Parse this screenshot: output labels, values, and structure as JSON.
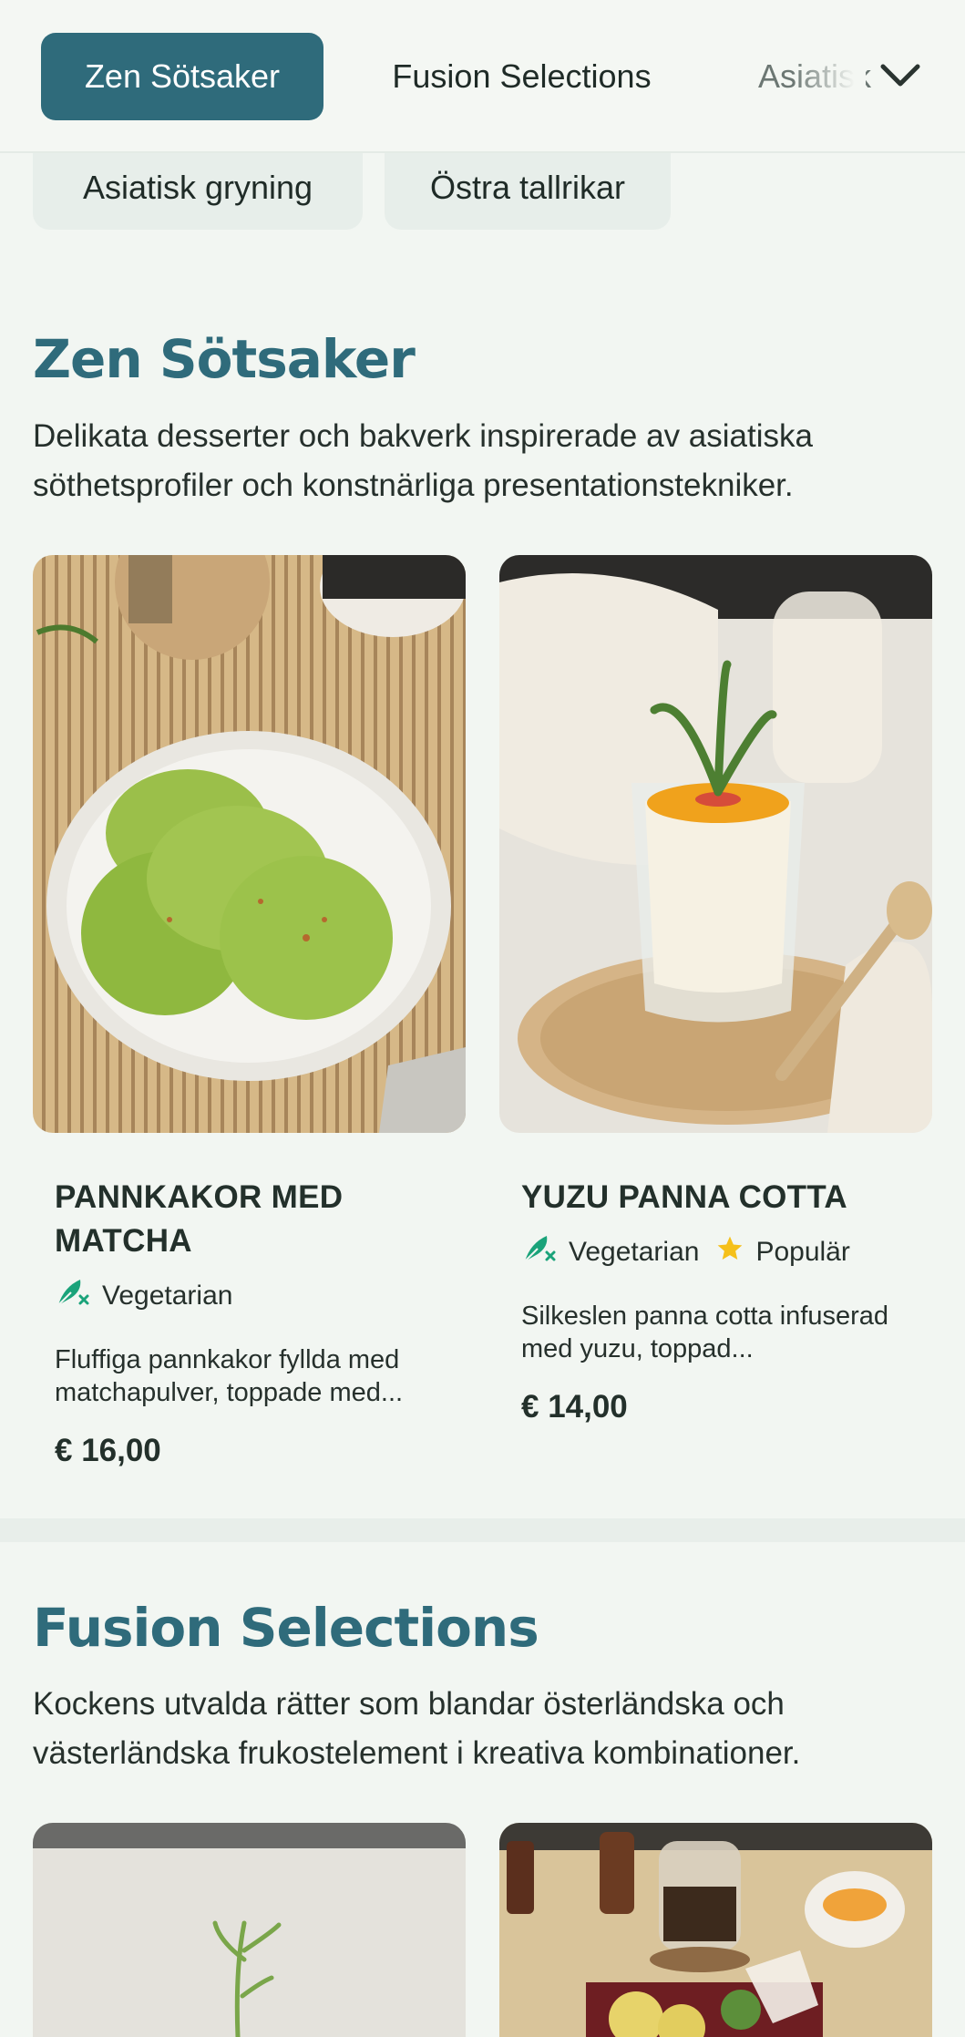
{
  "nav": {
    "tabs": [
      {
        "label": "Zen Sötsaker"
      },
      {
        "label": "Fusion Selections"
      },
      {
        "label": "Asiatisk"
      }
    ],
    "more_icon": "chevron-down-icon"
  },
  "subnav": {
    "chips": [
      {
        "label": "Asiatisk gryning"
      },
      {
        "label": "Östra tallrikar"
      }
    ]
  },
  "sections": [
    {
      "title": "Zen Sötsaker",
      "description": "Delikata desserter och bakverk inspirerade av asiatiska söthetsprofiler och konstnärliga presentationstekniker.",
      "items": [
        {
          "name": "PANNKAKOR MED MATCHA",
          "tags": [
            {
              "label": "Vegetarian",
              "icon": "vegetarian-icon"
            }
          ],
          "description": "Fluffiga pannkakor fyllda med matchapulver, toppade med...",
          "price": "€ 16,00"
        },
        {
          "name": "YUZU PANNA COTTA",
          "tags": [
            {
              "label": "Vegetarian",
              "icon": "vegetarian-icon"
            },
            {
              "label": "Populär",
              "icon": "star-icon"
            }
          ],
          "description": "Silkeslen panna cotta infuserad med yuzu, toppad...",
          "price": "€ 14,00"
        }
      ]
    },
    {
      "title": "Fusion Selections",
      "description": "Kockens utvalda rätter som blandar österländska och västerländska frukostelement i kreativa kombinationer."
    }
  ],
  "colors": {
    "accent": "#2f6b7b",
    "background": "#f2f6f2",
    "vegetarian": "#1aa37a",
    "star": "#f5c01a"
  }
}
